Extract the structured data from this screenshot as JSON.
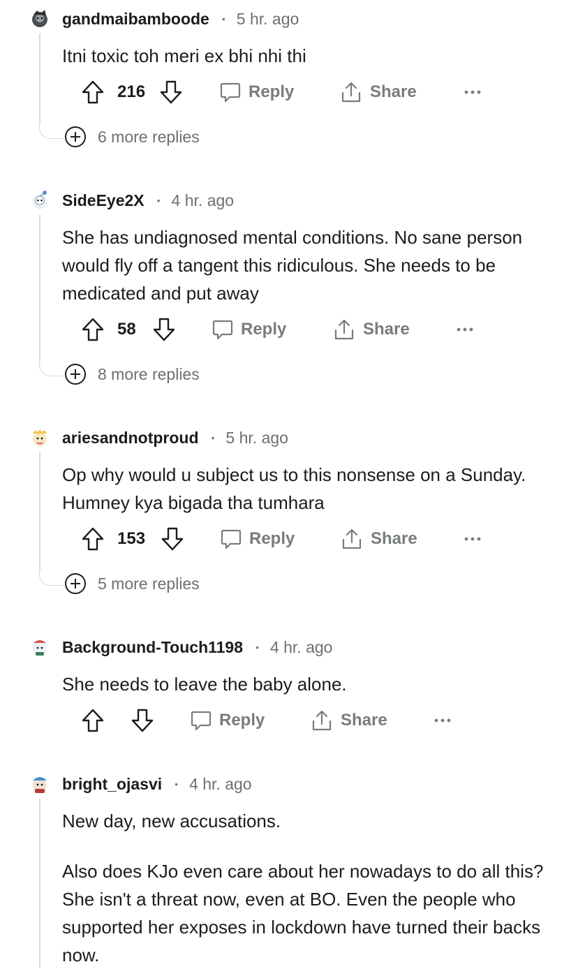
{
  "colors": {
    "text": "#1c1c1c",
    "meta": "#6b6f73",
    "icon": "#787c7e",
    "thread": "#d7d9db"
  },
  "icons": {
    "upvote": "arrow-up-outline-icon",
    "downvote": "arrow-down-outline-icon",
    "reply": "speech-bubble-icon",
    "share": "share-upload-icon",
    "more": "ellipsis-icon",
    "expand": "plus-circle-icon"
  },
  "comments": [
    {
      "username": "gandmaibamboode",
      "time": "5 hr. ago",
      "paragraphs": [
        "Itni toxic toh meri ex bhi nhi thi"
      ],
      "votes": "216",
      "reply_label": "Reply",
      "share_label": "Share",
      "more_replies": "6 more replies"
    },
    {
      "username": "SideEye2X",
      "time": "4 hr. ago",
      "paragraphs": [
        "She has undiagnosed mental conditions. No sane person would fly off a tangent this ridiculous. She needs to be medicated and put away"
      ],
      "votes": "58",
      "reply_label": "Reply",
      "share_label": "Share",
      "more_replies": "8 more replies"
    },
    {
      "username": "ariesandnotproud",
      "time": "5 hr. ago",
      "paragraphs": [
        "Op why would u subject us to this nonsense on a Sunday. Humney kya bigada tha tumhara"
      ],
      "votes": "153",
      "reply_label": "Reply",
      "share_label": "Share",
      "more_replies": "5 more replies"
    },
    {
      "username": "Background-Touch1198",
      "time": "4 hr. ago",
      "paragraphs": [
        "She needs to leave the baby alone."
      ],
      "votes": "",
      "reply_label": "Reply",
      "share_label": "Share",
      "more_replies": ""
    },
    {
      "username": "bright_ojasvi",
      "time": "4 hr. ago",
      "paragraphs": [
        "New day, new accusations.",
        "Also does KJo even care about her nowadays to do all this? She isn't a threat now, even at BO. Even the people who supported her exposes in lockdown have turned their backs now."
      ],
      "votes": "",
      "reply_label": "",
      "share_label": "",
      "more_replies": ""
    }
  ]
}
